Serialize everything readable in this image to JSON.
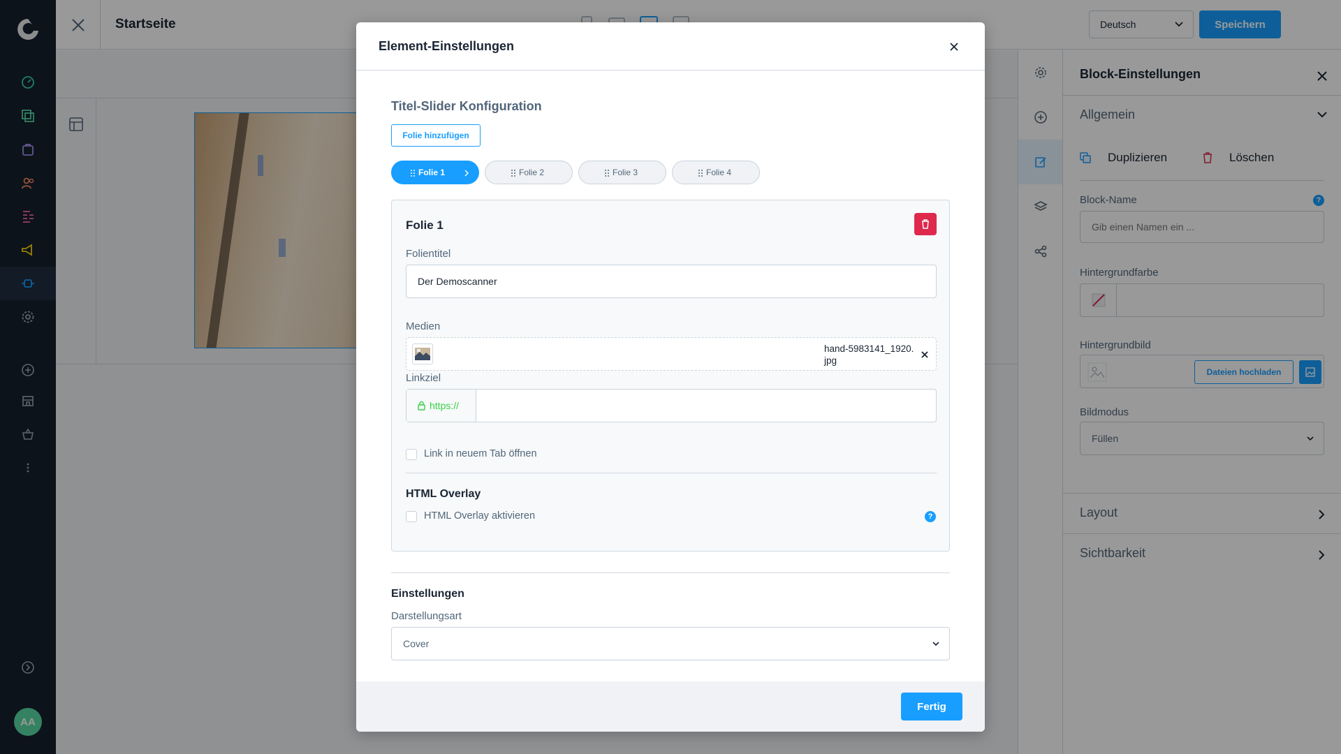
{
  "header": {
    "page_title": "Startseite",
    "language": "Deutsch",
    "save_label": "Speichern"
  },
  "user": {
    "initials": "AA"
  },
  "modal": {
    "title": "Element-Einstellungen",
    "section_title": "Titel-Slider Konfiguration",
    "add_slide_label": "Folie hinzufügen",
    "tabs": [
      {
        "label": "Folie 1"
      },
      {
        "label": "Folie 2"
      },
      {
        "label": "Folie 3"
      },
      {
        "label": "Folie 4"
      }
    ],
    "slide": {
      "heading": "Folie 1",
      "title_label": "Folientitel",
      "title_value": "Der Demoscanner",
      "media_label": "Medien",
      "media_file": "hand-5983141_1920.jpg",
      "link_label": "Linkziel",
      "link_prefix": "https://",
      "link_value": "",
      "new_tab_label": "Link in neuem Tab öffnen",
      "new_tab_checked": false,
      "overlay_heading": "HTML Overlay",
      "overlay_label": "HTML Overlay aktivieren",
      "overlay_checked": false
    },
    "settings": {
      "heading": "Einstellungen",
      "display_label": "Darstellungsart",
      "display_value": "Cover"
    },
    "done_label": "Fertig"
  },
  "block_settings": {
    "title": "Block-Einstellungen",
    "general": "Allgemein",
    "duplicate": "Duplizieren",
    "delete": "Löschen",
    "name_label": "Block-Name",
    "name_placeholder": "Gib einen Namen ein ...",
    "bg_color_label": "Hintergrundfarbe",
    "bg_image_label": "Hintergrundbild",
    "upload_label": "Dateien hochladen",
    "image_mode_label": "Bildmodus",
    "image_mode_value": "Füllen",
    "layout": "Layout",
    "visibility": "Sichtbarkeit"
  },
  "colors": {
    "accent": "#189eff",
    "danger": "#de294c",
    "nav_bg": "#16202d",
    "link_green": "#37d046"
  }
}
